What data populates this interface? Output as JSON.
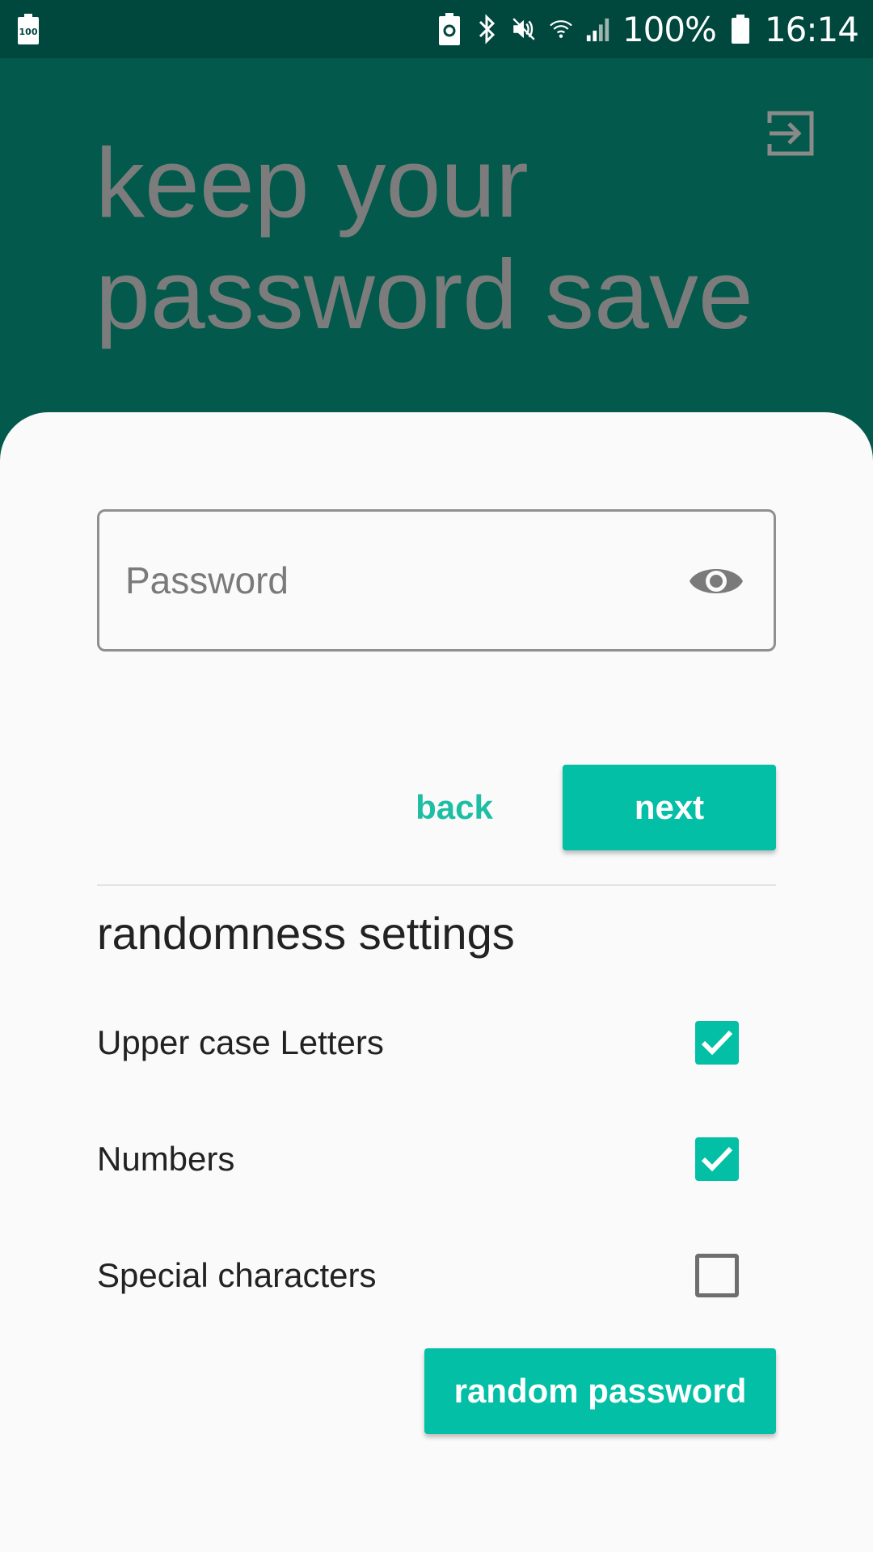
{
  "status_bar": {
    "battery_percent": "100%",
    "time": "16:14",
    "icons": [
      "battery-saver-icon",
      "recycle-battery-icon",
      "bluetooth-icon",
      "mute-icon",
      "wifi-icon",
      "signal-icon",
      "battery-icon"
    ],
    "battery_saver_label": "100"
  },
  "header": {
    "title": "keep your password save",
    "logout_icon": "logout-icon"
  },
  "password_field": {
    "placeholder": "Password",
    "value": "",
    "toggle_icon": "eye-icon"
  },
  "actions": {
    "back_label": "back",
    "next_label": "next"
  },
  "randomness": {
    "title": "randomness settings",
    "options": [
      {
        "label": "Upper case Letters",
        "checked": true
      },
      {
        "label": "Numbers",
        "checked": true
      },
      {
        "label": "Special characters",
        "checked": false
      }
    ],
    "generate_label": "random password"
  },
  "colors": {
    "status_bar": "#00473e",
    "header_bg": "#035a4c",
    "accent": "#02bfa5",
    "title_text": "#7c7c7c"
  }
}
